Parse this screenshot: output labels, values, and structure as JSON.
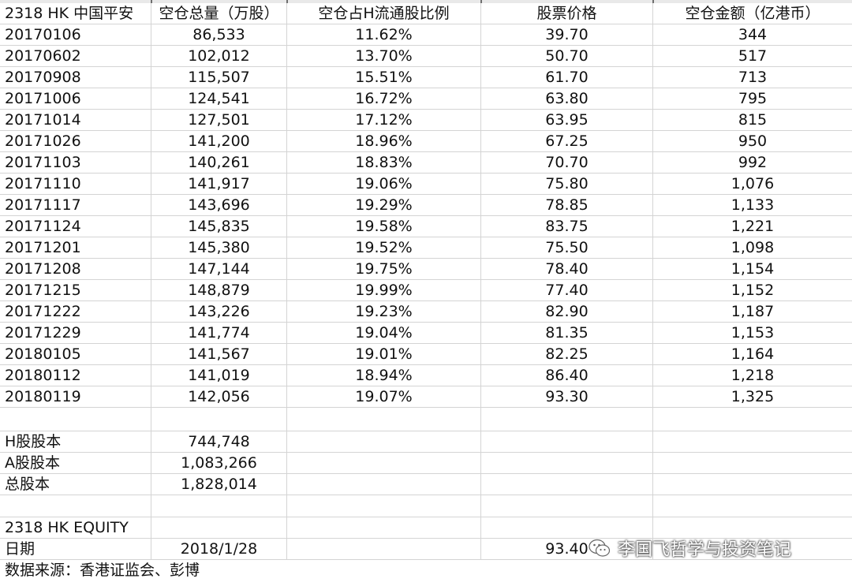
{
  "header": [
    "2318 HK 中国平安",
    "空仓总量（万股）",
    "空仓占H流通股比例",
    "股票价格",
    "空仓金额（亿港币）"
  ],
  "rows": [
    [
      "20170106",
      "86,533",
      "11.62%",
      "39.70",
      "344"
    ],
    [
      "20170602",
      "102,012",
      "13.70%",
      "50.70",
      "517"
    ],
    [
      "20170908",
      "115,507",
      "15.51%",
      "61.70",
      "713"
    ],
    [
      "20171006",
      "124,541",
      "16.72%",
      "63.80",
      "795"
    ],
    [
      "20171014",
      "127,501",
      "17.12%",
      "63.95",
      "815"
    ],
    [
      "20171026",
      "141,200",
      "18.96%",
      "67.25",
      "950"
    ],
    [
      "20171103",
      "140,261",
      "18.83%",
      "70.70",
      "992"
    ],
    [
      "20171110",
      "141,917",
      "19.06%",
      "75.80",
      "1,076"
    ],
    [
      "20171117",
      "143,696",
      "19.29%",
      "78.85",
      "1,133"
    ],
    [
      "20171124",
      "145,835",
      "19.58%",
      "83.75",
      "1,221"
    ],
    [
      "20171201",
      "145,380",
      "19.52%",
      "75.50",
      "1,098"
    ],
    [
      "20171208",
      "147,144",
      "19.75%",
      "78.40",
      "1,154"
    ],
    [
      "20171215",
      "148,879",
      "19.99%",
      "77.40",
      "1,152"
    ],
    [
      "20171222",
      "143,226",
      "19.23%",
      "82.90",
      "1,187"
    ],
    [
      "20171229",
      "141,774",
      "19.04%",
      "81.35",
      "1,153"
    ],
    [
      "20180105",
      "141,567",
      "19.01%",
      "82.25",
      "1,164"
    ],
    [
      "20180112",
      "141,019",
      "18.94%",
      "86.40",
      "1,218"
    ],
    [
      "20180119",
      "142,056",
      "19.07%",
      "93.30",
      "1,325"
    ]
  ],
  "capital": {
    "h_label": "H股股本",
    "h_value": "744,748",
    "a_label": "A股股本",
    "a_value": "1,083,266",
    "total_label": "总股本",
    "total_value": "1,828,014"
  },
  "equity": {
    "title": "2318 HK EQUITY",
    "date_label": "日期",
    "date_value": "2018/1/28",
    "price": "93.40"
  },
  "source": "数据来源：香港证监会、彭博",
  "watermark": {
    "text": "李国飞哲学与投资笔记",
    "icon": "wechat-icon"
  }
}
